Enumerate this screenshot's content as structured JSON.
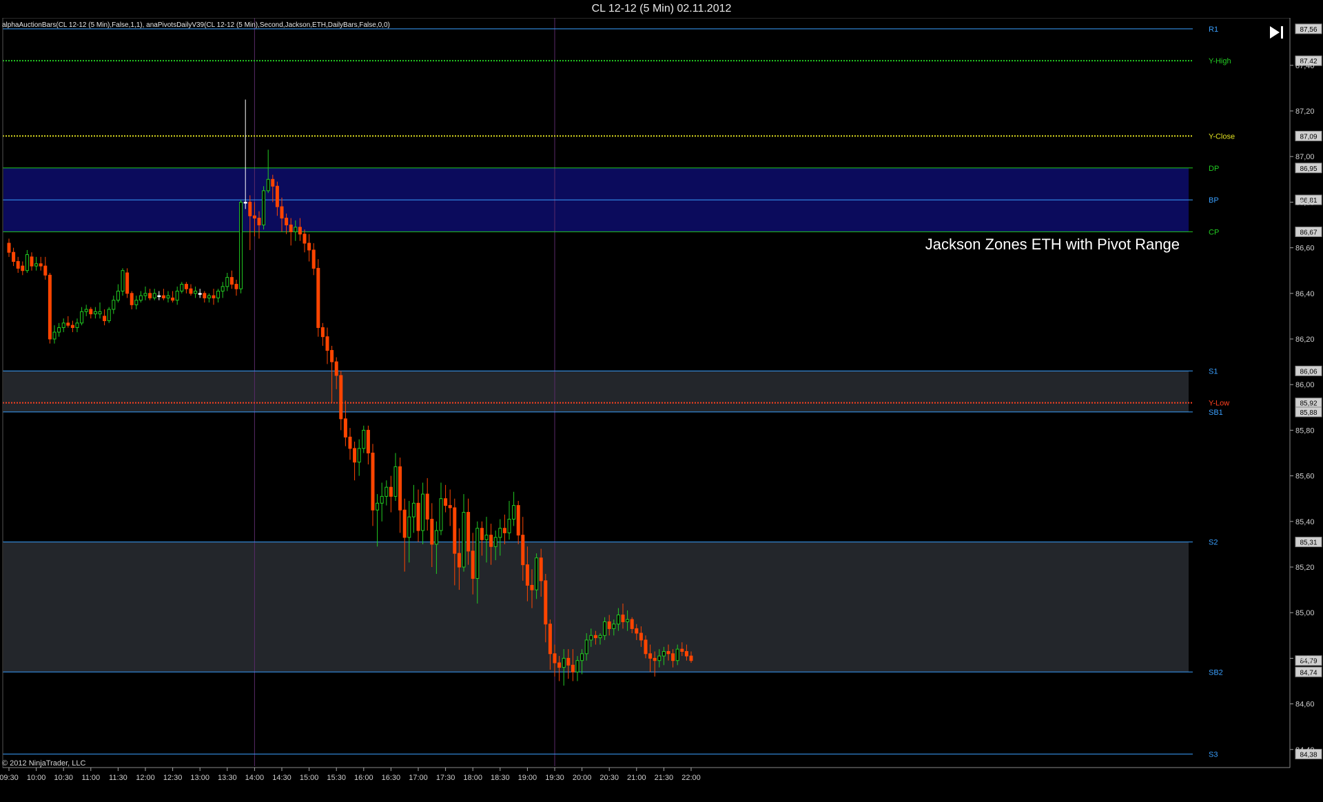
{
  "window": {
    "title": "CL 12-12 (5 Min)  02.11.2012"
  },
  "indicator_label": "alphaAuctionBars(CL 12-12 (5 Min),False,1,1), anaPivotsDailyV39(CL 12-12 (5 Min),Second,Jackson,ETH,DailyBars,False,0,0)",
  "annotation": "Jackson Zones ETH with Pivot Range",
  "copyright": "© 2012 NinjaTrader, LLC",
  "icons": {
    "skip_end": "skip-to-end-icon"
  },
  "colors": {
    "background": "#000000",
    "grid": "#2a2a2a",
    "up_candle": "#22cc22",
    "down_candle": "#ff4500",
    "doji": "#ffffff",
    "zone_pivot": "#0b0b5c",
    "zone_support": "#23262b",
    "level_line": "#3aa0ff",
    "y_high": "#22cc22",
    "y_close": "#e0e020",
    "y_low": "#ff4020"
  },
  "chart_data": {
    "type": "candlestick",
    "title": "CL 12-12 (5 Min)  02.11.2012",
    "ylim": [
      84.36,
      87.62
    ],
    "y_ticks": [
      "87,40",
      "87,20",
      "87,00",
      "86,80",
      "86,60",
      "86,40",
      "86,20",
      "86,00",
      "85,80",
      "85,60",
      "85,40",
      "85,20",
      "85,00",
      "84,80",
      "84,60",
      "84,40"
    ],
    "y_tick_values": [
      87.4,
      87.2,
      87.0,
      86.8,
      86.6,
      86.4,
      86.2,
      86.0,
      85.8,
      85.6,
      85.4,
      85.2,
      85.0,
      84.8,
      84.6,
      84.4
    ],
    "x_ticks": [
      "09:30",
      "10:00",
      "10:30",
      "11:00",
      "11:30",
      "12:00",
      "12:30",
      "13:00",
      "13:30",
      "14:00",
      "14:30",
      "15:00",
      "15:30",
      "16:00",
      "16:30",
      "17:00",
      "17:30",
      "18:00",
      "18:30",
      "19:00",
      "19:30",
      "20:00",
      "20:30",
      "21:00",
      "21:30",
      "22:00"
    ],
    "session_start_minutes": 570,
    "bar_minutes": 5,
    "session_breaks": [
      "14:00",
      "19:30"
    ],
    "levels": [
      {
        "name": "R1",
        "value": 87.56,
        "label": "87,56",
        "style": "solid",
        "color": "#3aa0ff"
      },
      {
        "name": "Y-High",
        "value": 87.42,
        "label": "87,42",
        "style": "dotted",
        "color": "#22cc22"
      },
      {
        "name": "Y-Close",
        "value": 87.09,
        "label": "87,09",
        "style": "dotted",
        "color": "#e0e020"
      },
      {
        "name": "DP",
        "value": 86.95,
        "label": "86,95",
        "style": "solid",
        "color": "#22cc22"
      },
      {
        "name": "BP",
        "value": 86.81,
        "label": "86,81",
        "style": "solid",
        "color": "#3aa0ff"
      },
      {
        "name": "CP",
        "value": 86.67,
        "label": "86,67",
        "style": "solid",
        "color": "#22cc22"
      },
      {
        "name": "S1",
        "value": 86.06,
        "label": "86,06",
        "style": "solid",
        "color": "#3aa0ff"
      },
      {
        "name": "Y-Low",
        "value": 85.92,
        "label": "85,92",
        "style": "dotted",
        "color": "#ff4020"
      },
      {
        "name": "SB1",
        "value": 85.88,
        "label": "85,88",
        "style": "solid",
        "color": "#3aa0ff"
      },
      {
        "name": "S2",
        "value": 85.31,
        "label": "85,31",
        "style": "solid",
        "color": "#3aa0ff"
      },
      {
        "name": "SB2",
        "value": 84.74,
        "label": "84,74",
        "style": "solid",
        "color": "#3aa0ff"
      },
      {
        "name": "S3",
        "value": 84.38,
        "label": "84,38",
        "style": "solid",
        "color": "#3aa0ff"
      }
    ],
    "zones": [
      {
        "name": "pivot-range",
        "from": 86.67,
        "to": 86.95,
        "color": "#0b0b5c"
      },
      {
        "name": "s1-zone",
        "from": 85.88,
        "to": 86.06,
        "color": "#23262b"
      },
      {
        "name": "s2-zone",
        "from": 84.74,
        "to": 85.31,
        "color": "#23262b"
      }
    ],
    "last_price": {
      "value": 84.79,
      "label": "84,79"
    },
    "ohlc": [
      [
        86.62,
        86.64,
        86.56,
        86.58
      ],
      [
        86.58,
        86.6,
        86.52,
        86.54
      ],
      [
        86.54,
        86.56,
        86.49,
        86.51
      ],
      [
        86.52,
        86.54,
        86.48,
        86.5
      ],
      [
        86.5,
        86.59,
        86.49,
        86.57
      ],
      [
        86.56,
        86.58,
        86.5,
        86.52
      ],
      [
        86.52,
        86.56,
        86.5,
        86.53
      ],
      [
        86.53,
        86.56,
        86.5,
        86.52
      ],
      [
        86.52,
        86.56,
        86.46,
        86.48
      ],
      [
        86.48,
        86.49,
        86.18,
        86.2
      ],
      [
        86.2,
        86.26,
        86.18,
        86.23
      ],
      [
        86.23,
        86.27,
        86.21,
        86.25
      ],
      [
        86.25,
        86.29,
        86.23,
        86.27
      ],
      [
        86.27,
        86.3,
        86.25,
        86.26
      ],
      [
        86.26,
        86.28,
        86.23,
        86.25
      ],
      [
        86.25,
        86.29,
        86.23,
        86.27
      ],
      [
        86.27,
        86.34,
        86.26,
        86.32
      ],
      [
        86.32,
        86.35,
        86.3,
        86.33
      ],
      [
        86.33,
        86.34,
        86.29,
        86.31
      ],
      [
        86.31,
        86.34,
        86.29,
        86.32
      ],
      [
        86.31,
        86.36,
        86.29,
        86.32
      ],
      [
        86.3,
        86.33,
        86.26,
        86.28
      ],
      [
        86.28,
        86.34,
        86.27,
        86.33
      ],
      [
        86.33,
        86.39,
        86.31,
        86.37
      ],
      [
        86.37,
        86.44,
        86.36,
        86.41
      ],
      [
        86.41,
        86.51,
        86.39,
        86.5
      ],
      [
        86.49,
        86.51,
        86.38,
        86.4
      ],
      [
        86.4,
        86.41,
        86.33,
        86.35
      ],
      [
        86.35,
        86.39,
        86.33,
        86.37
      ],
      [
        86.37,
        86.41,
        86.36,
        86.39
      ],
      [
        86.39,
        86.43,
        86.37,
        86.4
      ],
      [
        86.4,
        86.42,
        86.37,
        86.38
      ],
      [
        86.38,
        86.42,
        86.37,
        86.4
      ],
      [
        86.39,
        86.41,
        86.37,
        86.39
      ],
      [
        86.39,
        86.42,
        86.37,
        86.38
      ],
      [
        86.38,
        86.41,
        86.36,
        86.39
      ],
      [
        86.38,
        86.41,
        86.36,
        86.37
      ],
      [
        86.37,
        86.43,
        86.35,
        86.41
      ],
      [
        86.41,
        86.45,
        86.4,
        86.44
      ],
      [
        86.44,
        86.45,
        86.4,
        86.42
      ],
      [
        86.42,
        86.44,
        86.39,
        86.4
      ],
      [
        86.4,
        86.43,
        86.38,
        86.41
      ],
      [
        86.4,
        86.42,
        86.38,
        86.4
      ],
      [
        86.4,
        86.41,
        86.36,
        86.38
      ],
      [
        86.38,
        86.4,
        86.36,
        86.39
      ],
      [
        86.39,
        86.42,
        86.35,
        86.38
      ],
      [
        86.38,
        86.42,
        86.36,
        86.41
      ],
      [
        86.41,
        86.45,
        86.38,
        86.43
      ],
      [
        86.43,
        86.49,
        86.41,
        86.47
      ],
      [
        86.47,
        86.5,
        86.42,
        86.44
      ],
      [
        86.44,
        86.46,
        86.39,
        86.42
      ],
      [
        86.42,
        86.81,
        86.4,
        86.8
      ],
      [
        86.8,
        87.25,
        86.77,
        86.8
      ],
      [
        86.8,
        86.83,
        86.59,
        86.74
      ],
      [
        86.74,
        86.8,
        86.65,
        86.73
      ],
      [
        86.73,
        86.76,
        86.64,
        86.7
      ],
      [
        86.7,
        86.87,
        86.68,
        86.85
      ],
      [
        86.85,
        87.03,
        86.84,
        86.9
      ],
      [
        86.9,
        86.92,
        86.8,
        86.87
      ],
      [
        86.87,
        86.89,
        86.74,
        86.78
      ],
      [
        86.78,
        86.82,
        86.67,
        86.73
      ],
      [
        86.73,
        86.75,
        86.66,
        86.7
      ],
      [
        86.7,
        86.73,
        86.61,
        86.67
      ],
      [
        86.67,
        86.72,
        86.63,
        86.69
      ],
      [
        86.69,
        86.73,
        86.63,
        86.66
      ],
      [
        86.66,
        86.68,
        86.58,
        86.62
      ],
      [
        86.62,
        86.66,
        86.54,
        86.59
      ],
      [
        86.59,
        86.62,
        86.48,
        86.51
      ],
      [
        86.51,
        86.55,
        86.21,
        86.25
      ],
      [
        86.25,
        86.27,
        86.17,
        86.21
      ],
      [
        86.21,
        86.25,
        86.09,
        86.15
      ],
      [
        86.15,
        86.17,
        85.92,
        86.1
      ],
      [
        86.1,
        86.12,
        85.98,
        86.04
      ],
      [
        86.04,
        86.06,
        85.8,
        85.85
      ],
      [
        85.85,
        85.93,
        85.73,
        85.77
      ],
      [
        85.77,
        85.81,
        85.67,
        85.72
      ],
      [
        85.72,
        85.75,
        85.58,
        85.66
      ],
      [
        85.66,
        85.76,
        85.6,
        85.72
      ],
      [
        85.72,
        85.82,
        85.7,
        85.8
      ],
      [
        85.8,
        85.82,
        85.65,
        85.7
      ],
      [
        85.7,
        85.74,
        85.38,
        85.45
      ],
      [
        85.45,
        85.52,
        85.29,
        85.48
      ],
      [
        85.48,
        85.57,
        85.4,
        85.51
      ],
      [
        85.51,
        85.58,
        85.47,
        85.55
      ],
      [
        85.55,
        85.6,
        85.44,
        85.51
      ],
      [
        85.51,
        85.7,
        85.49,
        85.64
      ],
      [
        85.64,
        85.68,
        85.35,
        85.45
      ],
      [
        85.45,
        85.5,
        85.18,
        85.33
      ],
      [
        85.33,
        85.49,
        85.22,
        85.42
      ],
      [
        85.42,
        85.56,
        85.35,
        85.48
      ],
      [
        85.48,
        85.54,
        85.31,
        85.36
      ],
      [
        85.36,
        85.57,
        85.3,
        85.52
      ],
      [
        85.52,
        85.59,
        85.36,
        85.41
      ],
      [
        85.41,
        85.48,
        85.2,
        85.3
      ],
      [
        85.3,
        85.4,
        85.17,
        85.36
      ],
      [
        85.36,
        85.57,
        85.34,
        85.5
      ],
      [
        85.5,
        85.56,
        85.44,
        85.47
      ],
      [
        85.47,
        85.54,
        85.38,
        85.46
      ],
      [
        85.46,
        85.5,
        85.12,
        85.26
      ],
      [
        85.26,
        85.37,
        85.1,
        85.2
      ],
      [
        85.2,
        85.52,
        85.18,
        85.44
      ],
      [
        85.44,
        85.5,
        85.21,
        85.27
      ],
      [
        85.27,
        85.35,
        85.08,
        85.15
      ],
      [
        85.15,
        85.4,
        85.04,
        85.37
      ],
      [
        85.37,
        85.4,
        85.25,
        85.32
      ],
      [
        85.32,
        85.42,
        85.22,
        85.34
      ],
      [
        85.34,
        85.39,
        85.21,
        85.29
      ],
      [
        85.29,
        85.36,
        85.23,
        85.33
      ],
      [
        85.33,
        85.41,
        85.25,
        85.37
      ],
      [
        85.37,
        85.43,
        85.3,
        85.35
      ],
      [
        85.35,
        85.49,
        85.32,
        85.41
      ],
      [
        85.41,
        85.53,
        85.38,
        85.47
      ],
      [
        85.47,
        85.49,
        85.3,
        85.34
      ],
      [
        85.34,
        85.42,
        85.14,
        85.21
      ],
      [
        85.21,
        85.29,
        85.05,
        85.12
      ],
      [
        85.12,
        85.19,
        85.02,
        85.1
      ],
      [
        85.1,
        85.26,
        85.06,
        85.24
      ],
      [
        85.24,
        85.28,
        85.07,
        85.14
      ],
      [
        85.14,
        85.17,
        84.87,
        84.95
      ],
      [
        84.95,
        84.97,
        84.75,
        84.82
      ],
      [
        84.82,
        84.86,
        84.72,
        84.78
      ],
      [
        84.78,
        84.81,
        84.7,
        84.76
      ],
      [
        84.76,
        84.84,
        84.68,
        84.8
      ],
      [
        84.8,
        84.84,
        84.71,
        84.77
      ],
      [
        84.77,
        84.84,
        84.7,
        84.74
      ],
      [
        84.74,
        84.81,
        84.7,
        84.79
      ],
      [
        84.79,
        84.84,
        84.73,
        84.82
      ],
      [
        84.82,
        84.91,
        84.79,
        84.88
      ],
      [
        84.88,
        84.93,
        84.85,
        84.9
      ],
      [
        84.9,
        84.92,
        84.86,
        84.89
      ],
      [
        84.89,
        84.91,
        84.86,
        84.9
      ],
      [
        84.9,
        84.98,
        84.88,
        84.96
      ],
      [
        84.96,
        84.99,
        84.9,
        84.93
      ],
      [
        84.93,
        84.97,
        84.9,
        84.95
      ],
      [
        84.95,
        85.02,
        84.92,
        84.99
      ],
      [
        84.99,
        85.04,
        84.93,
        84.96
      ],
      [
        84.96,
        85.01,
        84.92,
        84.97
      ],
      [
        84.97,
        84.98,
        84.91,
        84.93
      ],
      [
        84.93,
        84.95,
        84.88,
        84.91
      ],
      [
        84.91,
        84.94,
        84.85,
        84.88
      ],
      [
        84.88,
        84.9,
        84.8,
        84.82
      ],
      [
        84.82,
        84.86,
        84.74,
        84.8
      ],
      [
        84.8,
        84.83,
        84.72,
        84.79
      ],
      [
        84.79,
        84.84,
        84.76,
        84.81
      ],
      [
        84.81,
        84.85,
        84.77,
        84.83
      ],
      [
        84.83,
        84.86,
        84.79,
        84.82
      ],
      [
        84.82,
        84.84,
        84.76,
        84.79
      ],
      [
        84.79,
        84.86,
        84.77,
        84.84
      ],
      [
        84.84,
        84.87,
        84.81,
        84.83
      ],
      [
        84.83,
        84.86,
        84.79,
        84.81
      ],
      [
        84.81,
        84.83,
        84.78,
        84.79
      ]
    ]
  }
}
